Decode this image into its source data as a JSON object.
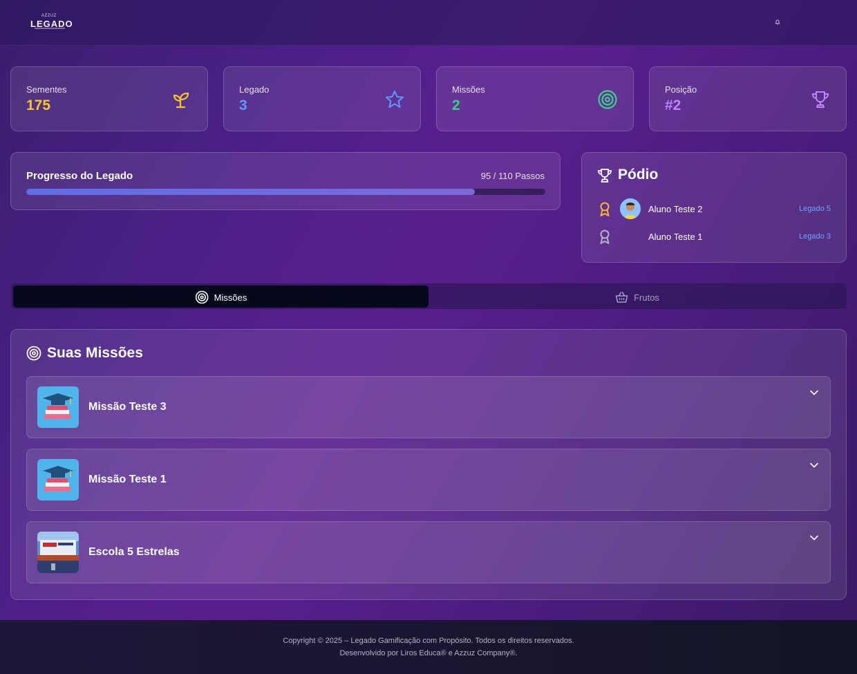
{
  "header": {
    "logo_small": "AZZUZ",
    "logo_main": "LEGADO",
    "bell_icon": "bell-icon"
  },
  "stats": [
    {
      "label": "Sementes",
      "value": "175",
      "icon": "sprout-icon",
      "color": "#f7c62f"
    },
    {
      "label": "Legado",
      "value": "3",
      "icon": "star-icon",
      "color": "#5b9bff"
    },
    {
      "label": "Missões",
      "value": "2",
      "icon": "target-icon",
      "color": "#3ad28a"
    },
    {
      "label": "Posição",
      "value": "#2",
      "icon": "trophy-icon",
      "color": "#c084fc"
    }
  ],
  "progress": {
    "title": "Progresso do Legado",
    "count": "95 / 110 Passos",
    "current": 95,
    "total": 110,
    "bar_color": "#6270e4"
  },
  "podio": {
    "title": "Pódio",
    "entries": [
      {
        "name": "Aluno Teste 2",
        "legado": "Legado 5",
        "medal": "gold-medal-icon",
        "has_avatar": true
      },
      {
        "name": "Aluno Teste 1",
        "legado": "Legado 3",
        "medal": "silver-medal-icon",
        "has_avatar": false
      }
    ]
  },
  "tabs": [
    {
      "label": "Missões",
      "icon": "target-icon",
      "active": true
    },
    {
      "label": "Frutos",
      "icon": "basket-icon",
      "active": false
    }
  ],
  "missions_section": {
    "title": "Suas Missões",
    "items": [
      {
        "title": "Missão Teste 3",
        "thumb": "graduation-books-thumb"
      },
      {
        "title": "Missão Teste 1",
        "thumb": "graduation-books-thumb"
      },
      {
        "title": "Escola 5 Estrelas",
        "thumb": "school-photo-thumb"
      }
    ]
  },
  "footer": {
    "line1": "Copyright © 2025 – Legado Gamificação com Propósito. Todos os direitos reservados.",
    "line2": "Desenvolvido por Liros Educa® e Azzuz Company®."
  }
}
